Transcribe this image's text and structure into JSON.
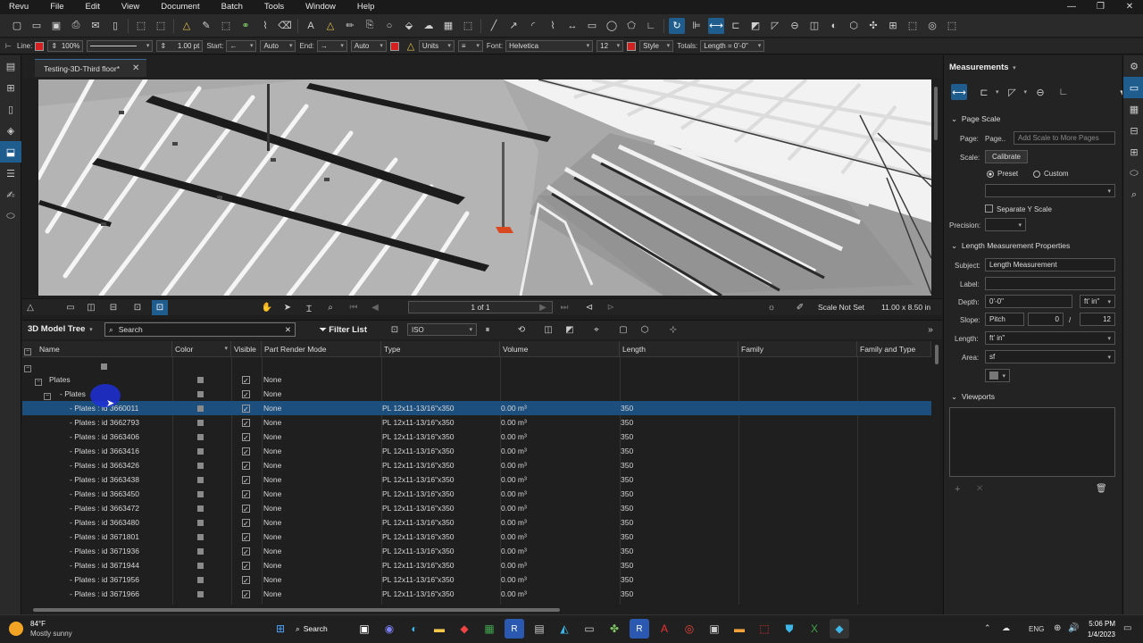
{
  "menu": [
    "Revu",
    "File",
    "Edit",
    "View",
    "Document",
    "Batch",
    "Tools",
    "Window",
    "Help"
  ],
  "window_controls": [
    "—",
    "❐",
    "✕"
  ],
  "props_toolbar": {
    "line_label": "Line:",
    "opacity": "100%",
    "width": "1.00 pt",
    "start_label": "Start:",
    "start_auto": "Auto",
    "end_label": "End:",
    "end_auto": "Auto",
    "units": "Units",
    "font_label": "Font:",
    "font_value": "Helvetica",
    "font_size": "12",
    "style": "Style",
    "totals_label": "Totals:",
    "totals_value": "Length = 0'-0\""
  },
  "document_tab": {
    "title": "Testing-3D-Third floor*",
    "close": "✕"
  },
  "navbar": {
    "page": "1 of 1",
    "scale": "Scale Not Set",
    "size": "11.00 x 8.50 in"
  },
  "model_tree": {
    "title": "3D Model Tree",
    "search_placeholder": "Search",
    "filter_list": "Filter List",
    "view_mode": "ISO"
  },
  "table": {
    "columns": [
      "Name",
      "Color",
      "Visible",
      "Part Render Mode",
      "Type",
      "Volume",
      "Length",
      "Family",
      "Family and Type"
    ],
    "group_rows": [
      {
        "name": "Plates",
        "mode": "None"
      },
      {
        "name": "- Plates",
        "mode": "None"
      }
    ],
    "rows": [
      {
        "name": "- Plates : id 3660011",
        "mode": "None",
        "type": "PL 12x11-13/16\"x350",
        "volume": "0.00 m³",
        "length": "350",
        "selected": true
      },
      {
        "name": "- Plates : id 3662793",
        "mode": "None",
        "type": "PL 12x11-13/16\"x350",
        "volume": "0.00 m³",
        "length": "350"
      },
      {
        "name": "- Plates : id 3663406",
        "mode": "None",
        "type": "PL 12x11-13/16\"x350",
        "volume": "0.00 m³",
        "length": "350"
      },
      {
        "name": "- Plates : id 3663416",
        "mode": "None",
        "type": "PL 12x11-13/16\"x350",
        "volume": "0.00 m³",
        "length": "350"
      },
      {
        "name": "- Plates : id 3663426",
        "mode": "None",
        "type": "PL 12x11-13/16\"x350",
        "volume": "0.00 m³",
        "length": "350"
      },
      {
        "name": "- Plates : id 3663438",
        "mode": "None",
        "type": "PL 12x11-13/16\"x350",
        "volume": "0.00 m³",
        "length": "350"
      },
      {
        "name": "- Plates : id 3663450",
        "mode": "None",
        "type": "PL 12x11-13/16\"x350",
        "volume": "0.00 m³",
        "length": "350"
      },
      {
        "name": "- Plates : id 3663472",
        "mode": "None",
        "type": "PL 12x11-13/16\"x350",
        "volume": "0.00 m³",
        "length": "350"
      },
      {
        "name": "- Plates : id 3663480",
        "mode": "None",
        "type": "PL 12x11-13/16\"x350",
        "volume": "0.00 m³",
        "length": "350"
      },
      {
        "name": "- Plates : id 3671801",
        "mode": "None",
        "type": "PL 12x11-13/16\"x350",
        "volume": "0.00 m³",
        "length": "350"
      },
      {
        "name": "- Plates : id 3671936",
        "mode": "None",
        "type": "PL 12x11-13/16\"x350",
        "volume": "0.00 m³",
        "length": "350"
      },
      {
        "name": "- Plates : id 3671944",
        "mode": "None",
        "type": "PL 12x11-13/16\"x350",
        "volume": "0.00 m³",
        "length": "350"
      },
      {
        "name": "- Plates : id 3671956",
        "mode": "None",
        "type": "PL 12x11-13/16\"x350",
        "volume": "0.00 m³",
        "length": "350"
      },
      {
        "name": "- Plates : id 3671966",
        "mode": "None",
        "type": "PL 12x11-13/16\"x350",
        "volume": "0.00 m³",
        "length": "350"
      }
    ]
  },
  "measurements": {
    "title": "Measurements",
    "page_scale": "Page Scale",
    "page_label": "Page:",
    "page_value": "Page..",
    "add_scale": "Add Scale to More Pages",
    "scale_label": "Scale:",
    "calibrate": "Calibrate",
    "preset": "Preset",
    "custom": "Custom",
    "separate_y": "Separate Y Scale",
    "precision_label": "Precision:",
    "length_props": "Length Measurement Properties",
    "subject_label": "Subject:",
    "subject_value": "Length Measurement",
    "label_label": "Label:",
    "depth_label": "Depth:",
    "depth_value": "0'-0\"",
    "depth_unit": "ft' in\"",
    "slope_label": "Slope:",
    "slope_value": "Pitch",
    "slope_num": "0",
    "slope_div": "/",
    "slope_den": "12",
    "length_label": "Length:",
    "length_value": "ft' in\"",
    "area_label": "Area:",
    "area_value": "sf",
    "viewports": "Viewports"
  },
  "taskbar": {
    "temp": "84°F",
    "weather": "Mostly sunny",
    "search": "Search",
    "lang": "ENG",
    "time": "5:06 PM",
    "date": "1/4/2023"
  },
  "colors": {
    "accent": "#1f5d8f",
    "selection": "#1c4f7e",
    "red_swatch": "#d42020"
  }
}
